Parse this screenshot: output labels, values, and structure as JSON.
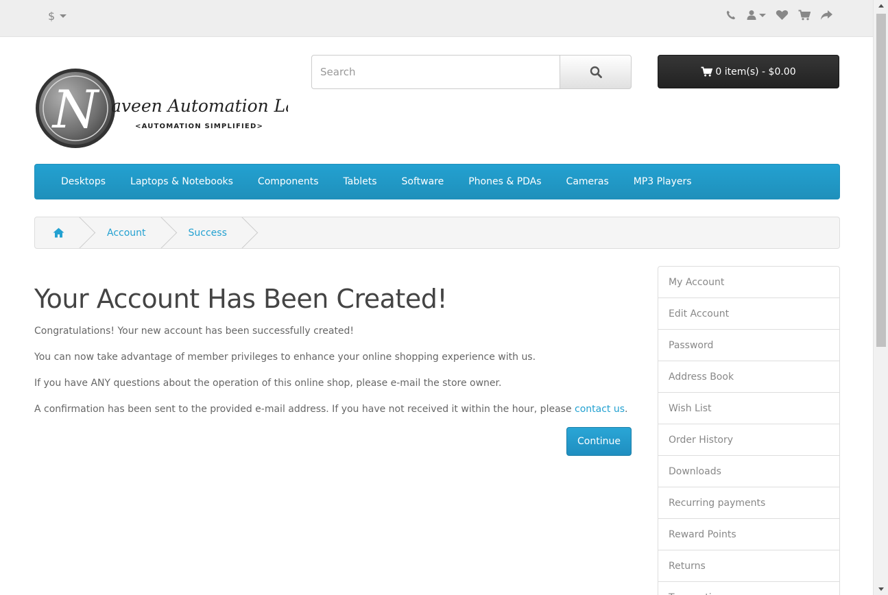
{
  "topbar": {
    "currency_symbol": "$",
    "icons": [
      "phone-icon",
      "user-icon",
      "heart-icon",
      "cart-icon",
      "share-icon"
    ]
  },
  "logo": {
    "letter": "N",
    "text": "aveen Automation Labs",
    "tagline": "<AUTOMATION SIMPLIFIED>"
  },
  "search": {
    "placeholder": "Search"
  },
  "cart": {
    "label": "0 item(s) - $0.00"
  },
  "menu": {
    "items": [
      "Desktops",
      "Laptops & Notebooks",
      "Components",
      "Tablets",
      "Software",
      "Phones & PDAs",
      "Cameras",
      "MP3 Players"
    ]
  },
  "breadcrumb": {
    "items": [
      "Account",
      "Success"
    ]
  },
  "main": {
    "title": "Your Account Has Been Created!",
    "p1": "Congratulations! Your new account has been successfully created!",
    "p2": "You can now take advantage of member privileges to enhance your online shopping experience with us.",
    "p3": "If you have ANY questions about the operation of this online shop, please e-mail the store owner.",
    "p4_prefix": "A confirmation has been sent to the provided e-mail address. If you have not received it within the hour, please ",
    "p4_link": "contact us",
    "p4_suffix": ".",
    "continue_label": "Continue"
  },
  "sidebar": {
    "items": [
      "My Account",
      "Edit Account",
      "Password",
      "Address Book",
      "Wish List",
      "Order History",
      "Downloads",
      "Recurring payments",
      "Reward Points",
      "Returns",
      "Transactions"
    ]
  },
  "colors": {
    "accent": "#23a1d1",
    "topbar_bg": "#eeeeee",
    "cart_bg": "#2b2b2b"
  }
}
